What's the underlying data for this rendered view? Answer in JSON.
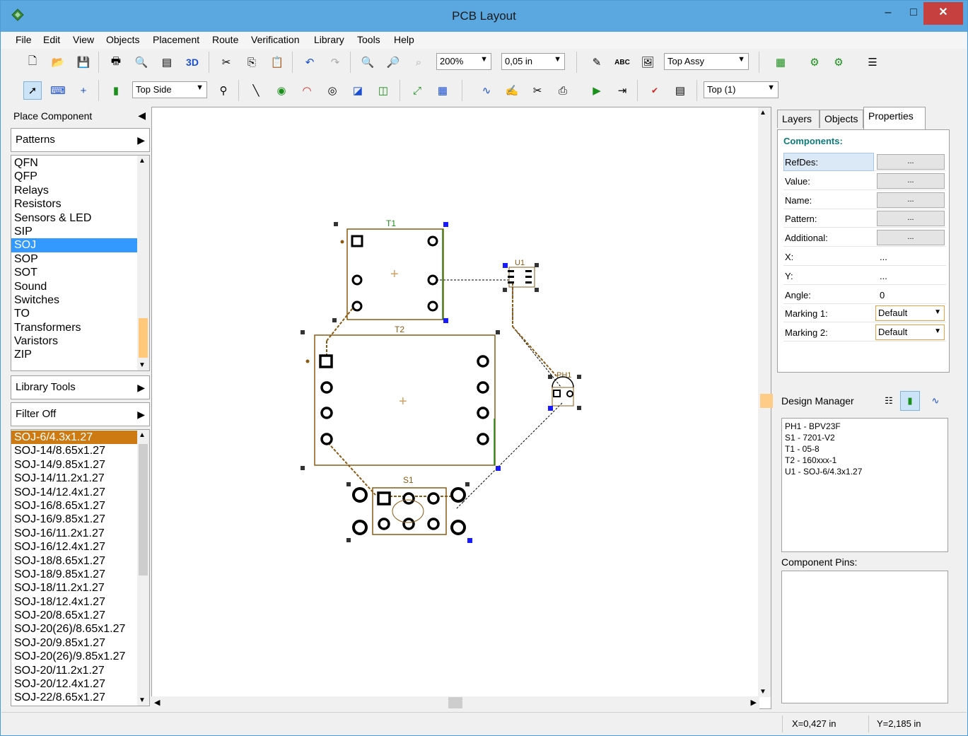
{
  "window": {
    "title": "PCB Layout",
    "min": "–",
    "max": "□",
    "close": "✕"
  },
  "menu": [
    {
      "label": "File"
    },
    {
      "label": "Edit"
    },
    {
      "label": "View"
    },
    {
      "label": "Objects"
    },
    {
      "label": "Placement"
    },
    {
      "label": "Route"
    },
    {
      "label": "Verification"
    },
    {
      "label": "Library"
    },
    {
      "label": "Tools"
    },
    {
      "label": "Help"
    }
  ],
  "toolbar1": {
    "btn_3d": "3D",
    "zoom": "200%",
    "grid": "0,05 in",
    "abc": "ABC",
    "assy": "Top Assy"
  },
  "toolbar2": {
    "side": "Top Side",
    "layer": "Top (1)"
  },
  "left_panel": {
    "title": "Place Component",
    "patterns_header": "Patterns",
    "patterns": [
      "QFN",
      "QFP",
      "Relays",
      "Resistors",
      "Sensors & LED",
      "SIP",
      "SOJ",
      "SOP",
      "SOT",
      "Sound",
      "Switches",
      "TO",
      "Transformers",
      "Varistors",
      "ZIP"
    ],
    "patterns_selected": 6,
    "library_tools": "Library Tools",
    "filter": "Filter Off",
    "components": [
      "SOJ-6/4.3x1.27",
      "SOJ-14/8.65x1.27",
      "SOJ-14/9.85x1.27",
      "SOJ-14/11.2x1.27",
      "SOJ-14/12.4x1.27",
      "SOJ-16/8.65x1.27",
      "SOJ-16/9.85x1.27",
      "SOJ-16/11.2x1.27",
      "SOJ-16/12.4x1.27",
      "SOJ-18/8.65x1.27",
      "SOJ-18/9.85x1.27",
      "SOJ-18/11.2x1.27",
      "SOJ-18/12.4x1.27",
      "SOJ-20/8.65x1.27",
      "SOJ-20(26)/8.65x1.27",
      "SOJ-20/9.85x1.27",
      "SOJ-20(26)/9.85x1.27",
      "SOJ-20/11.2x1.27",
      "SOJ-20/12.4x1.27",
      "SOJ-22/8.65x1.27"
    ],
    "components_selected": 0
  },
  "canvas": {
    "labels": {
      "t1": "T1",
      "t2": "T2",
      "u1": "U1",
      "ph1": "PH1",
      "s1": "S1"
    }
  },
  "right_panel": {
    "tabs": [
      "Layers",
      "Objects",
      "Properties"
    ],
    "active_tab": 2,
    "section": "Components:",
    "props": [
      {
        "label": "RefDes:",
        "kind": "button",
        "value": "..."
      },
      {
        "label": "Value:",
        "kind": "button",
        "value": "..."
      },
      {
        "label": "Name:",
        "kind": "button",
        "value": "..."
      },
      {
        "label": "Pattern:",
        "kind": "button",
        "value": "..."
      },
      {
        "label": "Additional:",
        "kind": "button",
        "value": "..."
      },
      {
        "label": "X:",
        "kind": "text",
        "value": "..."
      },
      {
        "label": "Y:",
        "kind": "text",
        "value": "..."
      },
      {
        "label": "Angle:",
        "kind": "text",
        "value": "0"
      },
      {
        "label": "Marking 1:",
        "kind": "dropdown",
        "value": "Default"
      },
      {
        "label": "Marking 2:",
        "kind": "dropdown",
        "value": "Default"
      }
    ],
    "design_manager": "Design Manager",
    "dm_items": [
      "PH1 - BPV23F",
      "S1 - 7201-V2",
      "T1 - 05-8",
      "T2 - 160xxx-1",
      "U1 - SOJ-6/4.3x1.27"
    ],
    "component_pins": "Component Pins:"
  },
  "status": {
    "x": "X=0,427 in",
    "y": "Y=2,185 in"
  },
  "colors": {
    "title_bar": "#5ba7e0",
    "close": "#c74040",
    "selection": "#3399ff",
    "selection_alt": "#cc7a11",
    "outline": "#8b5a14",
    "handle": "#1a1aff"
  }
}
